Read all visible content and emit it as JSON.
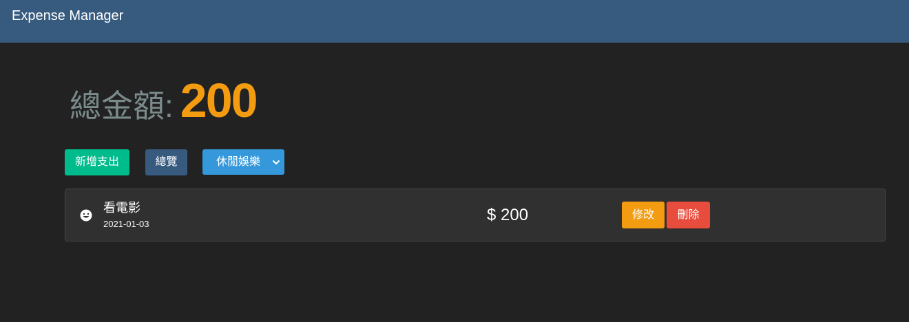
{
  "navbar": {
    "brand": "Expense Manager",
    "color": "#375a7f"
  },
  "summary": {
    "label": "總金額:",
    "total": "200",
    "total_color": "#f39c12"
  },
  "actions": {
    "add_label": "新增支出",
    "overview_label": "總覽",
    "category_select": {
      "selected": "休閒娛樂",
      "icon": "chevron-down-icon"
    }
  },
  "expenses": [
    {
      "icon": "smiley-icon",
      "title": "看電影",
      "date": "2021-01-03",
      "amount": "$ 200",
      "edit_label": "修改",
      "delete_label": "刪除"
    }
  ],
  "colors": {
    "background": "#222222",
    "add_button": "#00bc8c",
    "overview_button": "#375a7f",
    "select": "#3498db",
    "edit_button": "#f39c12",
    "delete_button": "#e74c3c"
  }
}
